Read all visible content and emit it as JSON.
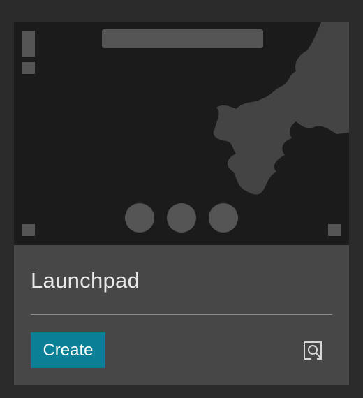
{
  "card": {
    "title": "Launchpad",
    "create_label": "Create",
    "preview_icon": "search-preview-icon"
  },
  "colors": {
    "page_background": "#2b2b2b",
    "card_background": "#474747",
    "thumbnail_background": "#1b1b1b",
    "thumbnail_shapes": "#555555",
    "accent": "#0a7f96",
    "title_text": "#e9e9e9"
  }
}
